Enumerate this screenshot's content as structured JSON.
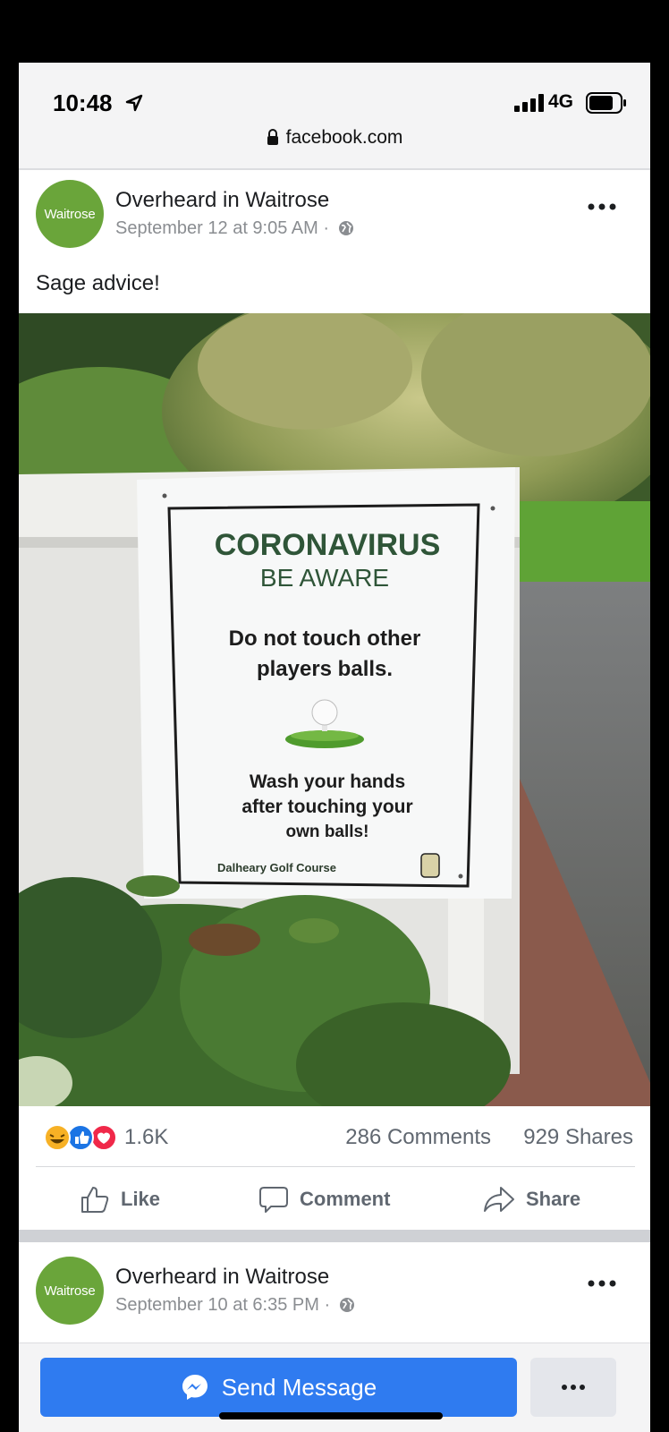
{
  "status_bar": {
    "time": "10:48",
    "network": "4G",
    "url": "facebook.com",
    "icons": [
      "location-arrow-icon",
      "signal-icon",
      "battery-icon",
      "lock-icon"
    ]
  },
  "post": {
    "avatar_text": "Waitrose",
    "page_name": "Overheard in Waitrose",
    "timestamp": "September 12 at 9:05 AM ·",
    "text": "Sage advice!",
    "sign": {
      "title": "CORONAVIRUS",
      "subtitle": "BE AWARE",
      "line1": "Do not touch other",
      "line2": "players balls.",
      "line3": "Wash your hands",
      "line4": "after touching your",
      "line5": "own balls!",
      "footer": "Dalheary Golf Course"
    },
    "reaction_count": "1.6K",
    "comments": "286 Comments",
    "shares": "929 Shares",
    "actions": {
      "like": "Like",
      "comment": "Comment",
      "share": "Share"
    }
  },
  "next_post": {
    "avatar_text": "Waitrose",
    "page_name": "Overheard in Waitrose",
    "timestamp": "September 10 at 6:35 PM ·"
  },
  "bottom_bar": {
    "send_label": "Send Message"
  },
  "colors": {
    "brand_green": "#6aa53a",
    "messenger_blue": "#2f7bf0",
    "text_primary": "#1c1e21",
    "text_secondary": "#606770"
  }
}
